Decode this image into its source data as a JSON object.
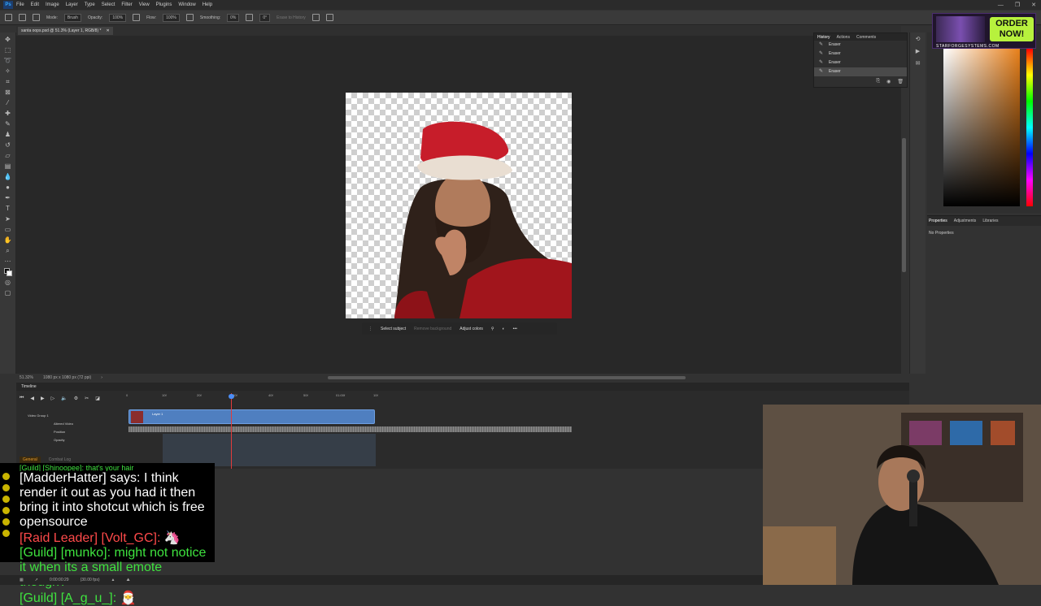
{
  "app": {
    "logo": "Ps",
    "menu": [
      "File",
      "Edit",
      "Image",
      "Layer",
      "Type",
      "Select",
      "Filter",
      "View",
      "Plugins",
      "Window",
      "Help"
    ],
    "window_controls": [
      "—",
      "❐",
      "✕"
    ]
  },
  "options_bar": {
    "mode_label": "Mode:",
    "mode_value": "Brush",
    "opacity_label": "Opacity:",
    "opacity_value": "100%",
    "flow_label": "Flow:",
    "flow_value": "100%",
    "smoothing_label": "Smoothing:",
    "smoothing_value": "0%",
    "angle_value": "0°",
    "erase_history": "Erase to History"
  },
  "document": {
    "tab_title": "santa oops.psd @ 51.3% (Layer 1, RGB/8) *",
    "zoom": "51.32%",
    "dimensions": "1080 px x 1080 px (72 ppi)"
  },
  "context_bar": {
    "select_subject": "Select subject",
    "remove_background": "Remove background",
    "adjust_colors": "Adjust colors",
    "more": "•••"
  },
  "history_panel": {
    "tabs": [
      "History",
      "Actions",
      "Comments"
    ],
    "items": [
      "Eraser",
      "Eraser",
      "Eraser",
      "Eraser"
    ],
    "selected_index": 3
  },
  "properties_panel": {
    "tabs": [
      "Properties",
      "Adjustments",
      "Libraries"
    ],
    "body": "No Properties"
  },
  "ad": {
    "button": "ORDER NOW!",
    "url": "STARFORGESYSTEMS.COM"
  },
  "timeline": {
    "title": "Timeline",
    "ruler": [
      "0",
      "10f",
      "20f",
      "30f",
      "40f",
      "50f",
      "01:00f",
      "10f"
    ],
    "tracks": [
      "Video Group 1",
      "Altered Video",
      "Position",
      "Opacity"
    ],
    "clip_name": "Layer 1",
    "timecode": "0:00:00:29",
    "fps": "(30.00 fps)"
  },
  "chat": {
    "tabs": [
      "General",
      "Combat Log"
    ],
    "lines": [
      {
        "prefix": "[Guild] [Shinoopee]:",
        "text": "that's your hair",
        "style": "guild"
      },
      {
        "prefix": "[MadderHatter] says:",
        "text": "I think render it out as you had it then bring it into shotcut which is free opensource",
        "style": "say"
      },
      {
        "prefix": "[Raid Leader] [Volt_GC]:",
        "text": "",
        "style": "raid"
      },
      {
        "prefix": "[Guild] [munko]:",
        "text": "might not notice it when its a small emote though?",
        "style": "guild"
      },
      {
        "prefix": "[Guild] [A_g_u_]:",
        "text": "",
        "style": "guild"
      }
    ]
  },
  "colors": {
    "accent_blue": "#4f7fc0",
    "playhead": "#e23b3b",
    "chat_guild": "#3fe33f",
    "chat_raid": "#ff4a4a",
    "ad_green": "#b7f13d"
  }
}
